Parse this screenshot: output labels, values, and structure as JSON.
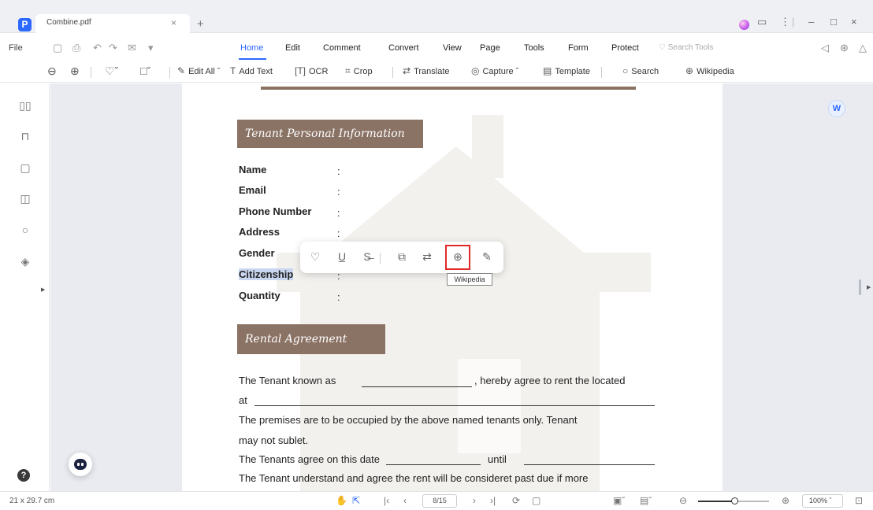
{
  "titlebar": {
    "app_logo": "P",
    "tab_title": "Combine.pdf",
    "tab_close": "×",
    "new_tab": "+",
    "window_controls": [
      "⋮",
      "|",
      "–",
      "□",
      "×"
    ]
  },
  "menubar": {
    "file": "File",
    "items": [
      "Home",
      "Edit",
      "Comment",
      "Convert",
      "View",
      "Page",
      "Tools",
      "Form",
      "Protect"
    ],
    "active": "Home",
    "search_tools_placeholder": "Search Tools"
  },
  "toolbar": {
    "edit_all": "Edit All",
    "add_text": "Add Text",
    "ocr": "OCR",
    "crop": "Crop",
    "translate": "Translate",
    "capture": "Capture",
    "template": "Template",
    "search": "Search",
    "wikipedia": "Wikipedia"
  },
  "document": {
    "section1_title": "Tenant Personal Information",
    "fields": [
      "Name",
      "Email",
      "Phone Number",
      "Address",
      "Gender",
      "Citizenship",
      "Quantity"
    ],
    "colon": ":",
    "section2_title": "Rental Agreement",
    "para1_a": "The Tenant known as",
    "para1_b": ", hereby agree to rent the located",
    "para1_c": "at",
    "para2_a": "The premises are to be occupied by the above named tenants only. Tenant",
    "para2_b": "may not sublet.",
    "para3_a": "The Tenants agree on this date",
    "para3_b": "until",
    "para4": "The Tenant understand and agree the rent will be consideret past due if more"
  },
  "selection_toolbar": {
    "tooltip": "Wikipedia"
  },
  "statusbar": {
    "page_size": "21 x 29.7 cm",
    "page_indicator": "8/15",
    "zoom": "100%"
  },
  "colors": {
    "accent": "#2d68ff",
    "section_header": "#8a7264",
    "highlight_box": "#e02828",
    "selection": "#c9d6f0"
  }
}
